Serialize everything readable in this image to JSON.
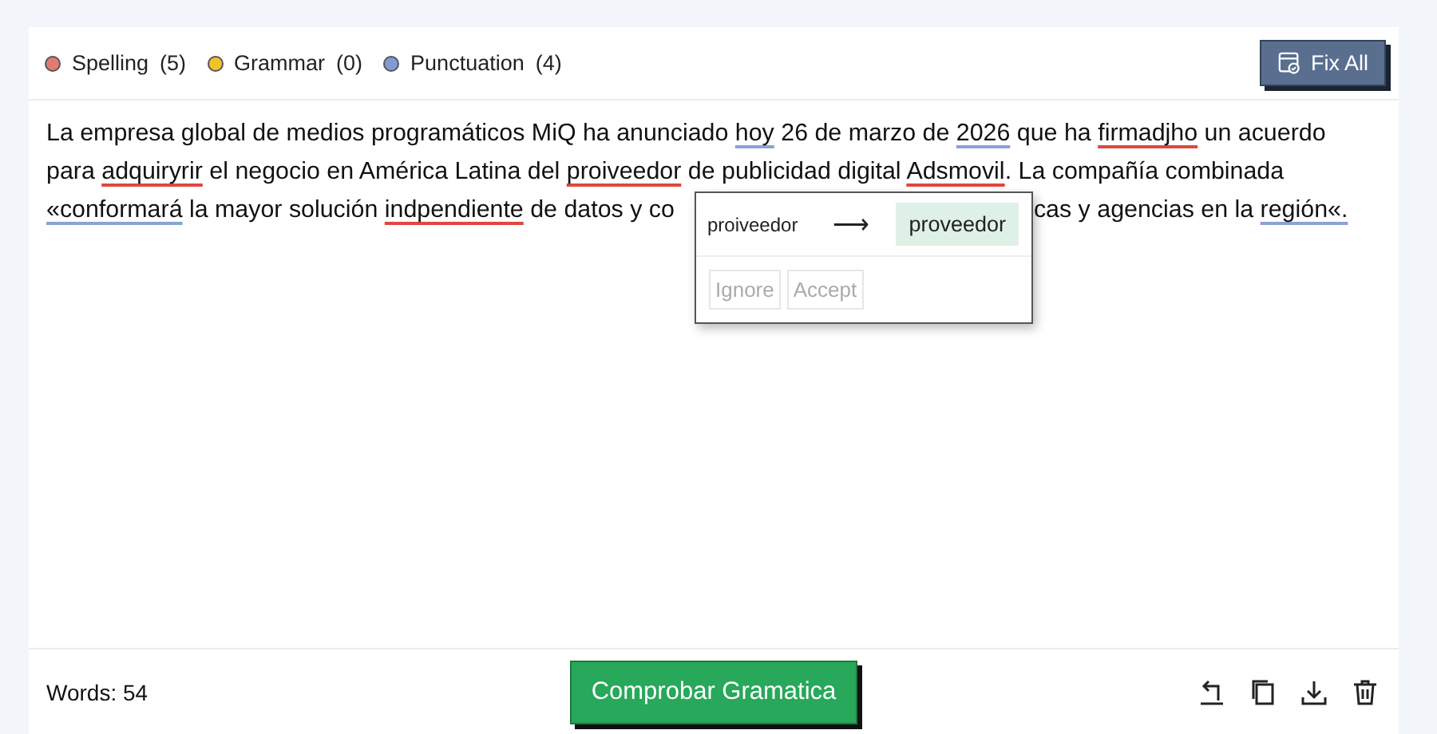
{
  "legend": [
    {
      "label": "Spelling",
      "count": "(5)",
      "color": "#e07a72"
    },
    {
      "label": "Grammar",
      "count": "(0)",
      "color": "#f2c12e"
    },
    {
      "label": "Punctuation",
      "count": "(4)",
      "color": "#7f9bd6"
    }
  ],
  "fix_all_button": "Fix All",
  "document": {
    "lines": [
      [
        {
          "kind": "text",
          "text": "La empresa global de medios programáticos MiQ ha anunciado "
        },
        {
          "kind": "punctuation",
          "text": "hoy"
        },
        {
          "kind": "text",
          "text": " 26 de marzo de "
        },
        {
          "kind": "punctuation",
          "text": "2026"
        },
        {
          "kind": "text",
          "text": " que ha "
        },
        {
          "kind": "spelling",
          "text": "firmadjho"
        },
        {
          "kind": "text",
          "text": " un acuerdo"
        }
      ],
      [
        {
          "kind": "text",
          "text": "para "
        },
        {
          "kind": "spelling",
          "text": "adquiryrir"
        },
        {
          "kind": "text",
          "text": " el negocio en América Latina del "
        },
        {
          "kind": "spelling",
          "text": "proiveedor"
        },
        {
          "kind": "text",
          "text": " de publicidad digital "
        },
        {
          "kind": "spelling",
          "text": "Adsmovil"
        },
        {
          "kind": "text",
          "text": ". La compañía combinada"
        }
      ],
      [
        {
          "kind": "punctuation",
          "text": "«conformará"
        },
        {
          "kind": "text",
          "text": " la mayor solución "
        },
        {
          "kind": "spelling",
          "text": "indpendiente"
        },
        {
          "kind": "text",
          "text": " de datos y co"
        },
        {
          "kind": "covered"
        },
        {
          "kind": "text",
          "text": "cas y agencias en la "
        },
        {
          "kind": "punctuation",
          "text": "región«."
        }
      ]
    ]
  },
  "suggestion": {
    "original": "proiveedor",
    "arrow": "⟶",
    "replacement": "proveedor",
    "buttons": [
      {
        "label": "Ignore",
        "disabled": true
      },
      {
        "label": "Accept",
        "disabled": true
      }
    ]
  },
  "footer": {
    "word_count": "Words: 54",
    "check_button": "Comprobar Gramatica",
    "tools": [
      {
        "kind": "undo"
      },
      {
        "kind": "copy"
      },
      {
        "kind": "download"
      },
      {
        "kind": "delete"
      }
    ]
  }
}
